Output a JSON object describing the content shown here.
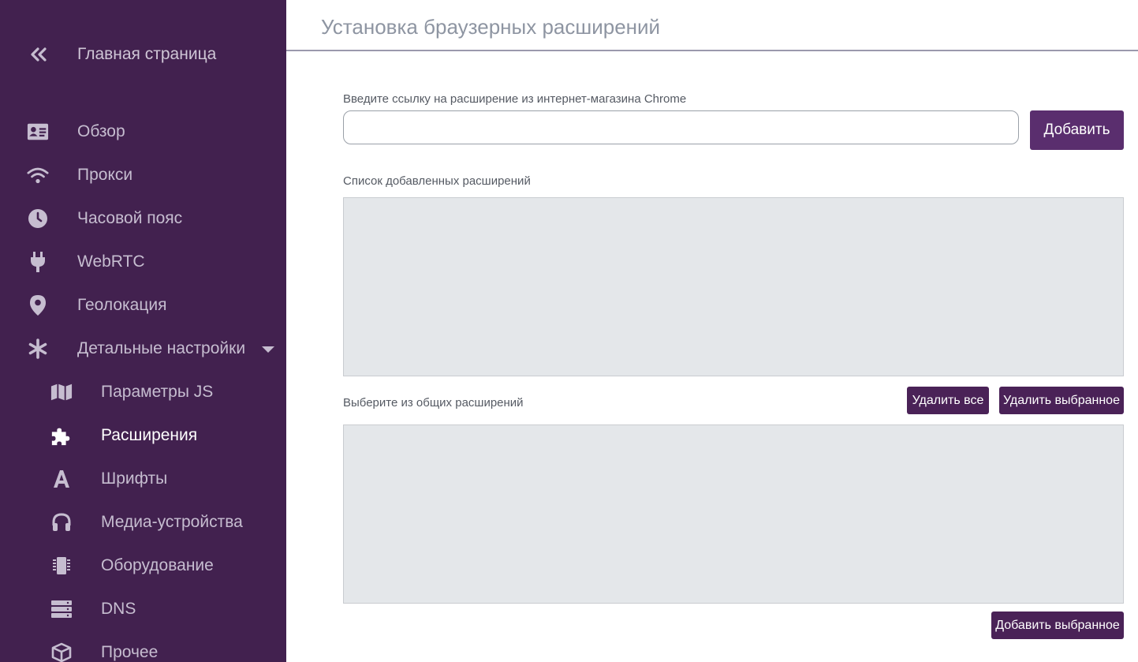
{
  "sidebar": {
    "home_label": "Главная страница",
    "items": [
      {
        "label": "Обзор",
        "icon": "id-card-icon"
      },
      {
        "label": "Прокси",
        "icon": "wifi-icon"
      },
      {
        "label": "Часовой пояс",
        "icon": "clock-icon"
      },
      {
        "label": "WebRTC",
        "icon": "plug-icon"
      },
      {
        "label": "Геолокация",
        "icon": "map-marker-icon"
      },
      {
        "label": "Детальные настройки",
        "icon": "asterisk-icon"
      },
      {
        "label": "Параметры JS",
        "icon": "map-icon"
      },
      {
        "label": "Расширения",
        "icon": "puzzle-icon"
      },
      {
        "label": "Шрифты",
        "icon": "font-icon"
      },
      {
        "label": "Медиа-устройства",
        "icon": "headphones-icon"
      },
      {
        "label": "Оборудование",
        "icon": "microchip-icon"
      },
      {
        "label": "DNS",
        "icon": "server-icon"
      },
      {
        "label": "Прочее",
        "icon": "cube-icon"
      }
    ]
  },
  "header": {
    "title": "Установка браузерных расширений"
  },
  "main": {
    "url_label": "Введите ссылку на расширение из интернет-магазина Chrome",
    "url_value": "",
    "add_button": "Добавить",
    "added_list_label": "Список добавленных расширений",
    "common_label": "Выберите из общих расширений",
    "delete_all_button": "Удалить все",
    "delete_selected_button": "Удалить выбранное",
    "add_selected_button": "Добавить выбранное"
  },
  "colors": {
    "sidebar_bg": "#42214f",
    "accent": "#5a2e6e",
    "listbox_bg": "#e4e7ea"
  }
}
